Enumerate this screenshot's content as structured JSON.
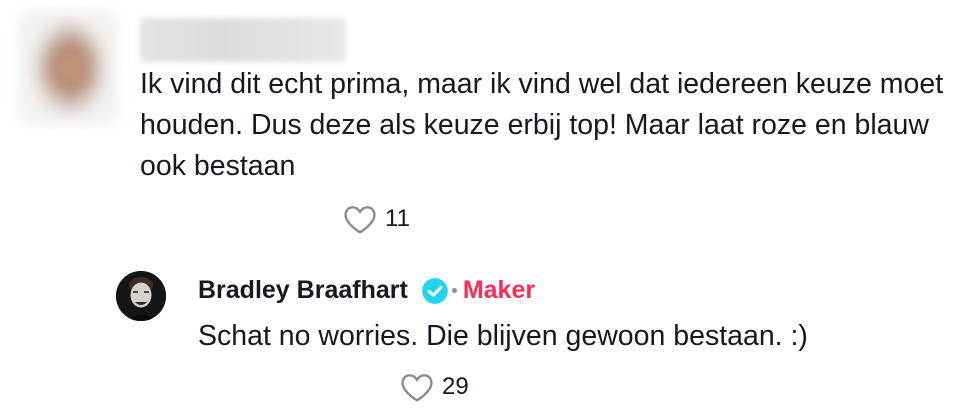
{
  "comment": {
    "text": "Ik vind dit echt prima, maar ik vind wel dat iedereen keuze moet houden. Dus deze als keuze erbij top! Maar laat roze en blauw ook bestaan",
    "likes": "11",
    "icon": "heart-outline-icon"
  },
  "reply": {
    "author": "Bradley Braafhart",
    "badge": "Maker",
    "verified_icon": "verified-badge-icon",
    "text": "Schat no worries. Die blijven gewoon bestaan. :)",
    "likes": "29",
    "icon": "heart-outline-icon"
  },
  "colors": {
    "text": "#161823",
    "maker": "#fe2c55",
    "verified": "#20d5ec",
    "icon": "#8a8b91"
  }
}
